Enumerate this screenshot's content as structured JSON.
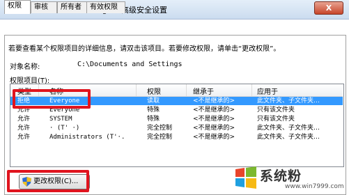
{
  "window": {
    "title": "Documents and Settings 的高级安全设置",
    "close_label": "X"
  },
  "tabs": [
    {
      "label": "权限"
    },
    {
      "label": "审核"
    },
    {
      "label": "所有者"
    },
    {
      "label": "有效权限"
    }
  ],
  "panel": {
    "description": "若要查看某个权限项目的详细信息，请双击该项目。若要修改权限，请单击“更改权限”。",
    "object_name_label": "对象名称:",
    "object_name_value": "C:\\Documents and Settings",
    "entries_label": "权限项目(T):"
  },
  "table": {
    "columns": [
      "类型",
      "名称",
      "权限",
      "继承于",
      "应用于"
    ],
    "rows": [
      {
        "type": "拒绝",
        "name": "Everyone",
        "permission": "读取",
        "inherited": "<不是继承的>",
        "applies_to": "此文件夹、子文件夹…",
        "selected": true
      },
      {
        "type": "允许",
        "name": "Everyone",
        "permission": "特殊",
        "inherited": "<不是继承的>",
        "applies_to": "只有该文件夹",
        "selected": false
      },
      {
        "type": "允许",
        "name": "SYSTEM",
        "permission": "特殊",
        "inherited": "<不是继承的>",
        "applies_to": "只有该文件夹",
        "selected": false
      },
      {
        "type": "允许",
        "name": "· (T'      ·)",
        "permission": "完全控制",
        "inherited": "<不是继承的>",
        "applies_to": "此文件夹、子文件夹…",
        "selected": false
      },
      {
        "type": "允许",
        "name": "Administrators (T'·.",
        "permission": "完全控制",
        "inherited": "<不是继承的>",
        "applies_to": "此文件夹、子文件夹…",
        "selected": false
      }
    ]
  },
  "buttons": {
    "change_permissions": "更改权限(C)..."
  },
  "watermark": {
    "brand": "系统粉",
    "url": "www.win7999.com"
  },
  "colors": {
    "highlight_red": "#e0141e",
    "selection_blue": "#3399ff"
  }
}
